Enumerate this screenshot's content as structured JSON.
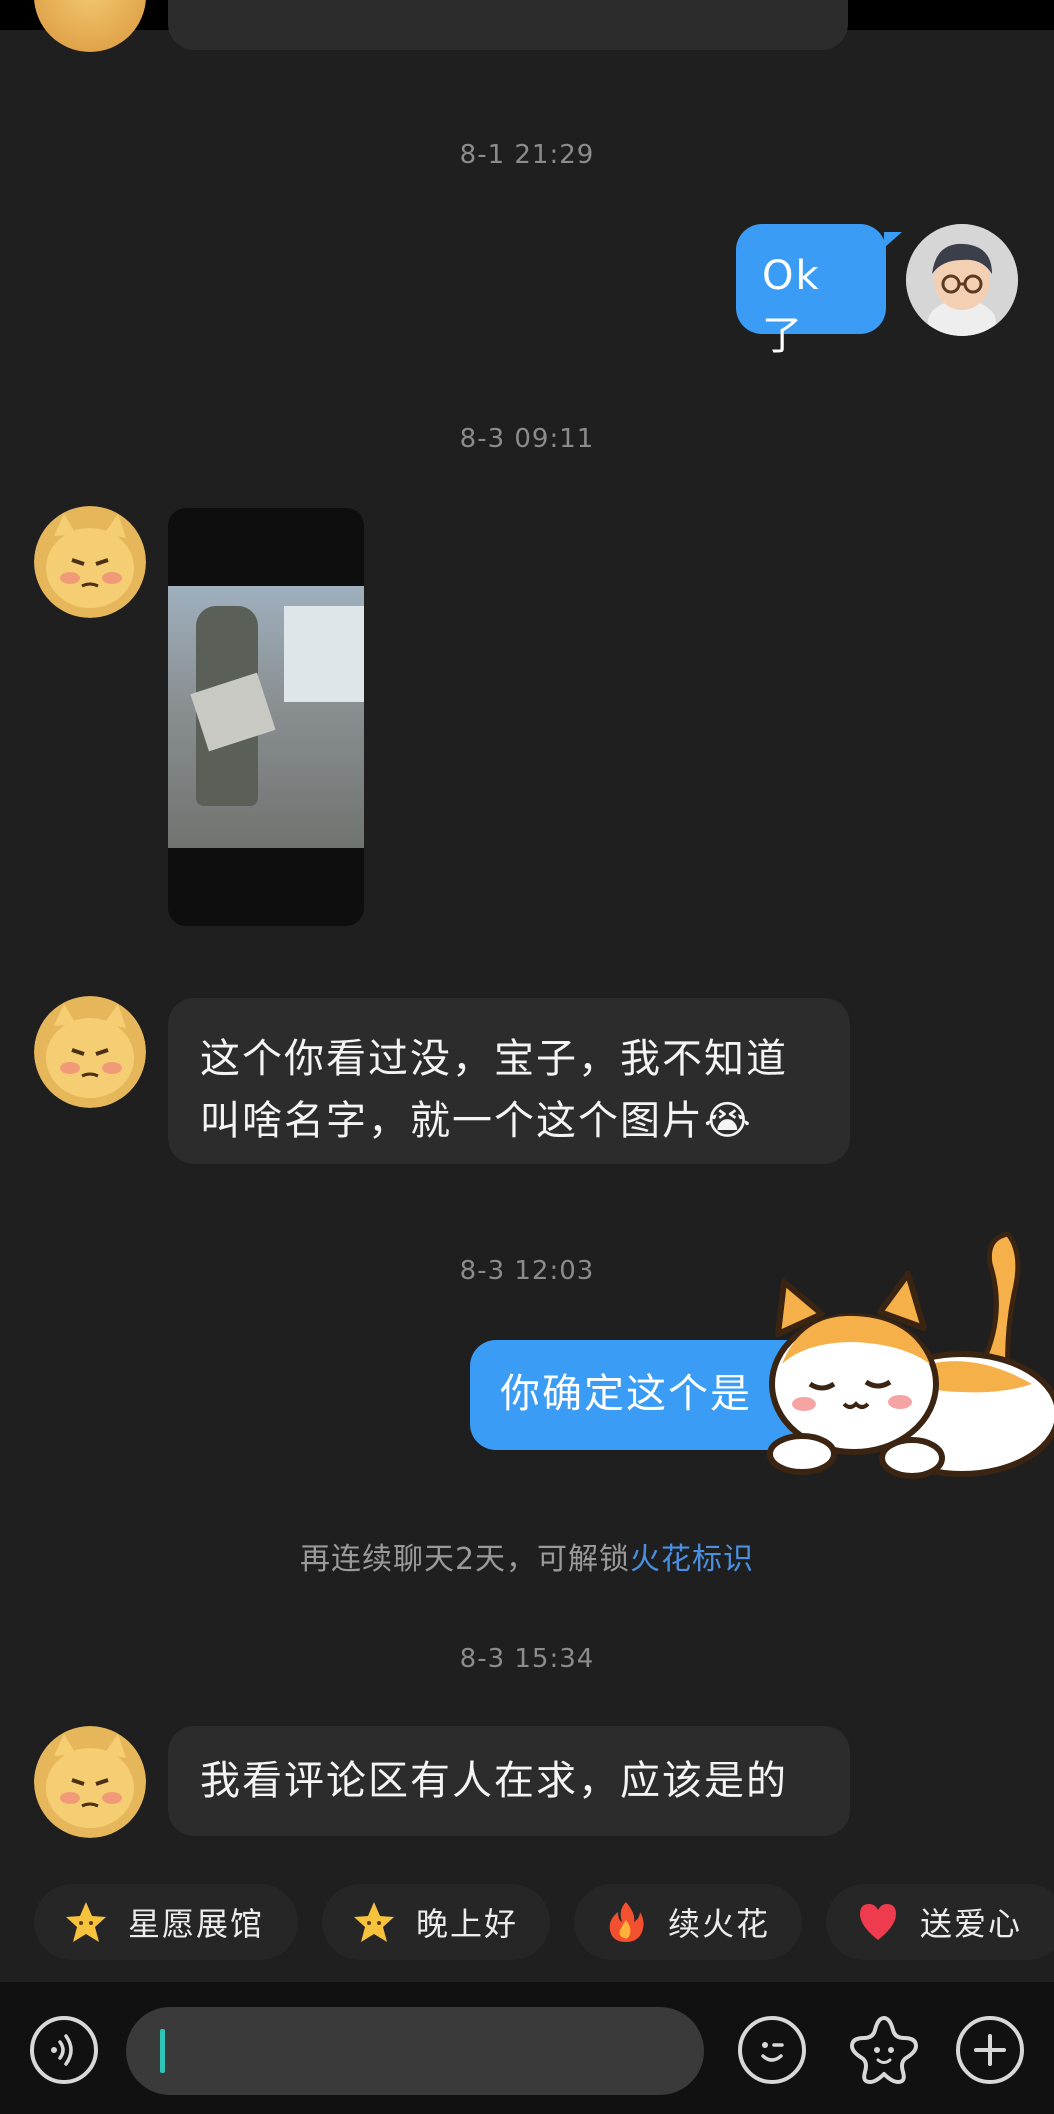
{
  "chat": {
    "timestamps": [
      "8-1 21:29",
      "8-3 09:11",
      "8-3 12:03",
      "8-3 15:34"
    ],
    "messages": {
      "ok": "Ok了",
      "question": "这个你看过没，宝子，我不知道叫啥名字，就一个这个图片",
      "question_emoji": "😭",
      "confirm": "你确定这个是",
      "answer": "我看评论区有人在求，应该是的"
    },
    "notice": {
      "prefix": "再连续聊天2天，可解锁",
      "highlight": "火花标识",
      "highlight_color": "#4a90e2"
    }
  },
  "quick_actions": [
    {
      "label": "星愿展馆",
      "icon": "star-face-icon"
    },
    {
      "label": "晚上好",
      "icon": "star-face-icon"
    },
    {
      "label": "续火花",
      "icon": "flame-icon"
    },
    {
      "label": "送爱心",
      "icon": "heart-icon"
    }
  ],
  "input": {
    "placeholder": "",
    "icons": [
      "voice-icon",
      "emoji-icon",
      "sticker-icon",
      "plus-icon"
    ]
  },
  "colors": {
    "background": "#1f1f1f",
    "incoming_bubble": "#2c2c2c",
    "outgoing_bubble": "#3a9cf5"
  }
}
